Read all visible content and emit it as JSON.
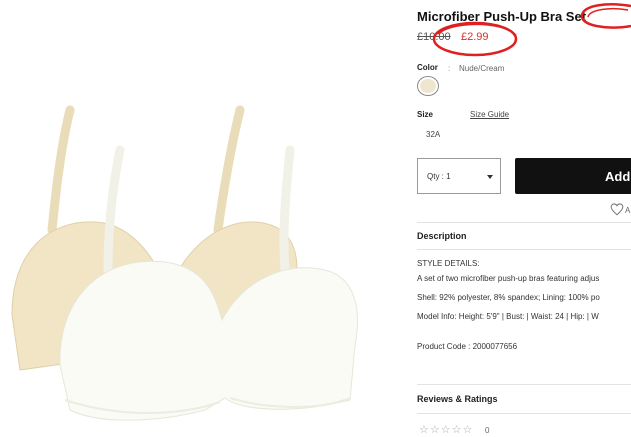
{
  "product": {
    "title": "Microfiber Push-Up Bra Set",
    "old_price": "£10.00",
    "new_price": "£2.99",
    "color_label": "Color",
    "color_separator": ":",
    "color_value": "Nude/Cream",
    "size_label": "Size",
    "size_guide_label": "Size Guide",
    "size_value": "32A",
    "qty_label": "Qty : 1",
    "add_button_label": "Add",
    "wishlist_label": "A"
  },
  "description": {
    "heading": "Description",
    "lines": [
      "STYLE DETAILS:",
      "A set of two microfiber push-up bras featuring adjus",
      "Shell: 92% polyester, 8% spandex; Lining: 100% po",
      "Model Info: Height: 5'9\" | Bust: | Waist: 24 | Hip: | W",
      "Product Code : 2000077656"
    ]
  },
  "reviews": {
    "heading": "Reviews & Ratings",
    "stars": "☆☆☆☆☆",
    "count": "0"
  },
  "colors": {
    "price_red": "#d0342c",
    "annotation_red": "#e02020",
    "button_black": "#111111",
    "swatch": "#f0e6cf"
  },
  "icons": [
    "heart-icon",
    "chevron-down-icon",
    "color-swatch"
  ]
}
